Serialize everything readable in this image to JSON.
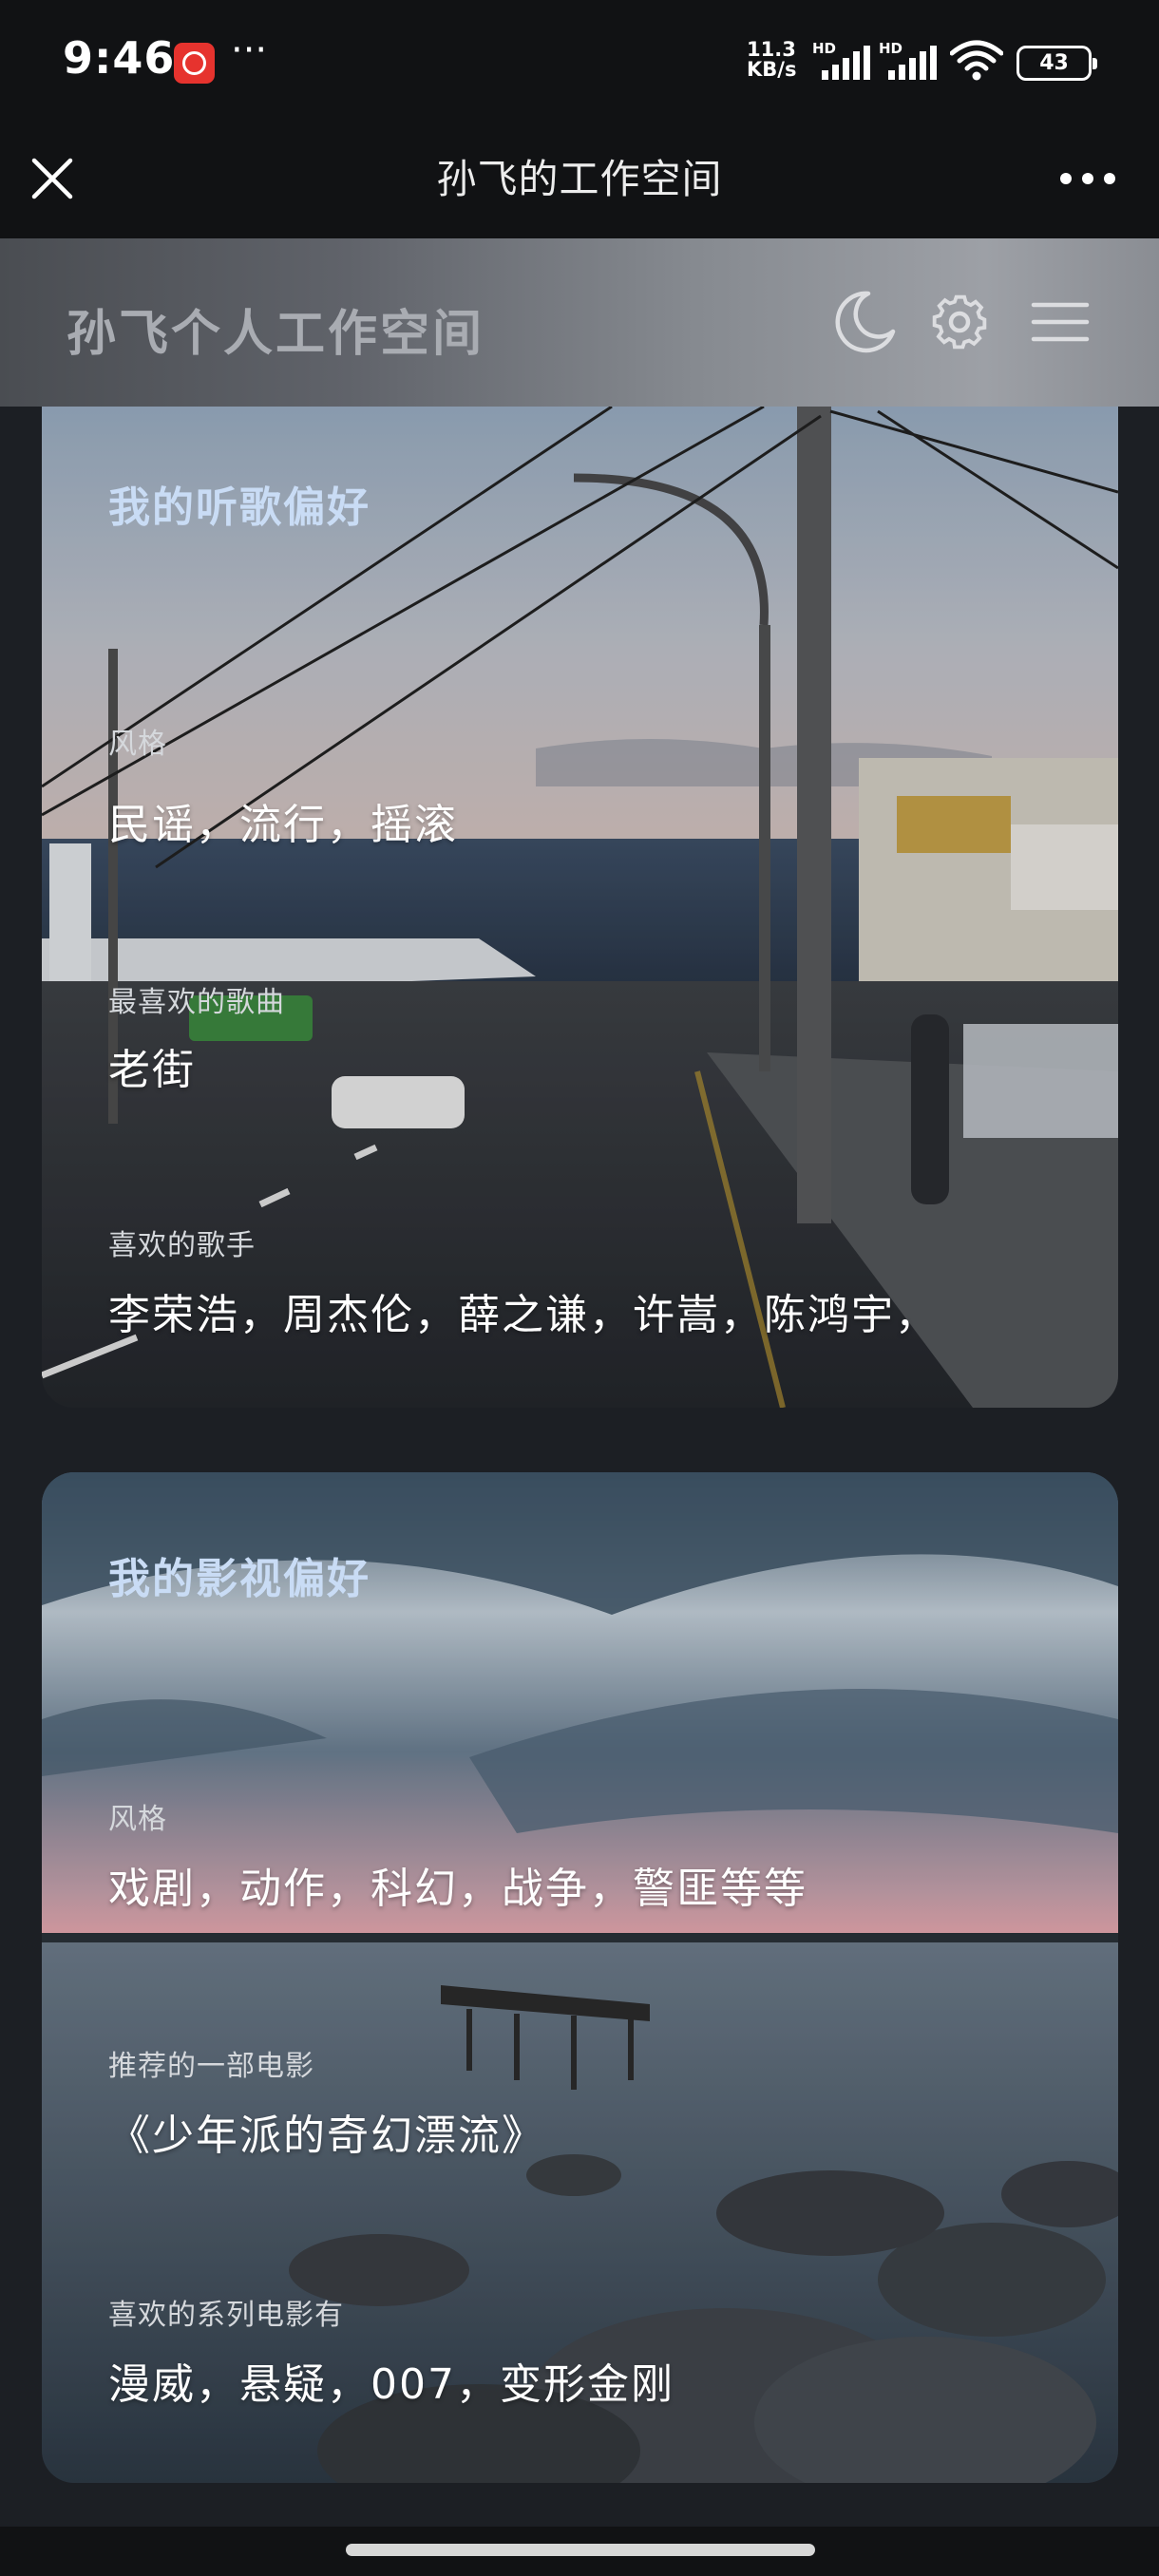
{
  "status_bar": {
    "time": "9:46",
    "net_speed_value": "11.3",
    "net_speed_unit": "KB/s",
    "sim1_label": "HD",
    "sim2_label": "HD",
    "battery": "43"
  },
  "title_bar": {
    "title": "孙飞的工作空间"
  },
  "header": {
    "title": "孙飞个人工作空间",
    "icons": [
      "moon-icon",
      "gear-icon",
      "menu-icon"
    ]
  },
  "music_card": {
    "title": "我的听歌偏好",
    "style_label": "风格",
    "style_value": "民谣，流行，摇滚",
    "song_label": "最喜欢的歌曲",
    "song_value": "老街",
    "singer_label": "喜欢的歌手",
    "singer_value": "李荣浩，周杰伦，薛之谦，许嵩，陈鸿宇，"
  },
  "film_card": {
    "title": "我的影视偏好",
    "style_label": "风格",
    "style_value": "戏剧，动作，科幻，战争，警匪等等",
    "movie_label": "推荐的一部电影",
    "movie_value": "《少年派的奇幻漂流》",
    "series_label": "喜欢的系列电影有",
    "series_value": "漫威，悬疑，007，变形金刚"
  },
  "colors": {
    "background": "#1c1f24",
    "card_title": "#c9dcf5",
    "status_bar": "#111214"
  }
}
